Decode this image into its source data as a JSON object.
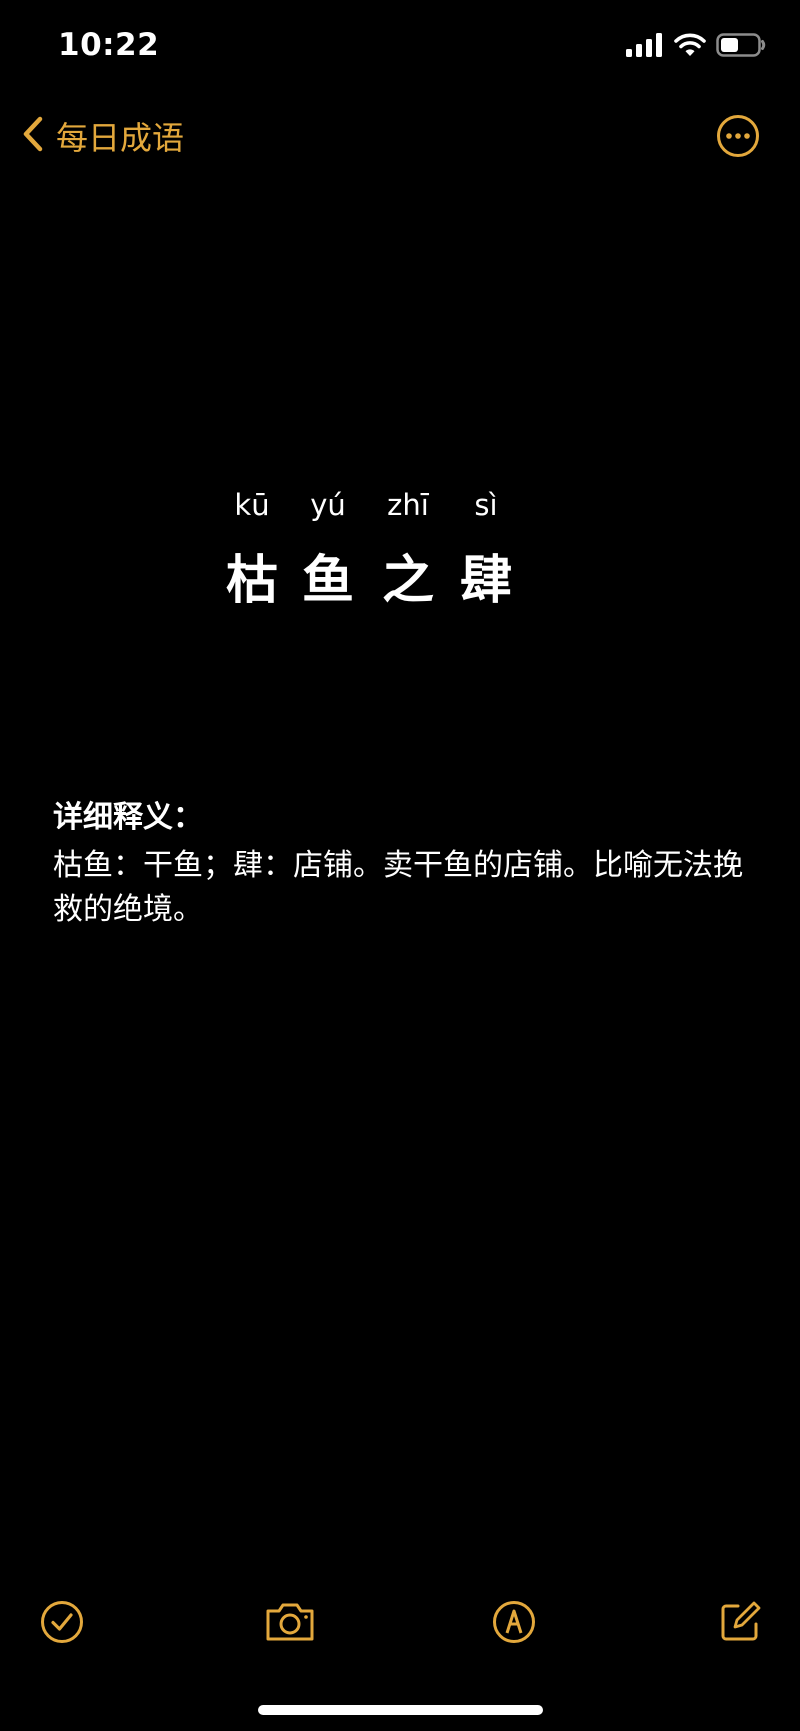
{
  "status_bar": {
    "time": "10:22",
    "icons": [
      "cellular-signal-icon",
      "wifi-icon",
      "battery-icon"
    ]
  },
  "nav": {
    "back_label": "每日成语",
    "back_icon": "chevron-left-icon",
    "more_icon": "ellipsis-circle-icon"
  },
  "idiom": {
    "pinyin": [
      "kū",
      "yú",
      "zhī",
      "sì"
    ],
    "characters": [
      "枯",
      "鱼",
      "之",
      "肆"
    ]
  },
  "definition": {
    "heading": "详细释义：",
    "body": "枯鱼：干鱼；肆：店铺。卖干鱼的店铺。比喻无法挽救的绝境。"
  },
  "toolbar": {
    "items": [
      "checklist-icon",
      "camera-icon",
      "markup-icon",
      "compose-icon"
    ]
  },
  "colors": {
    "accent": "#E3A83C",
    "background": "#000000",
    "text": "#FFFFFF"
  }
}
